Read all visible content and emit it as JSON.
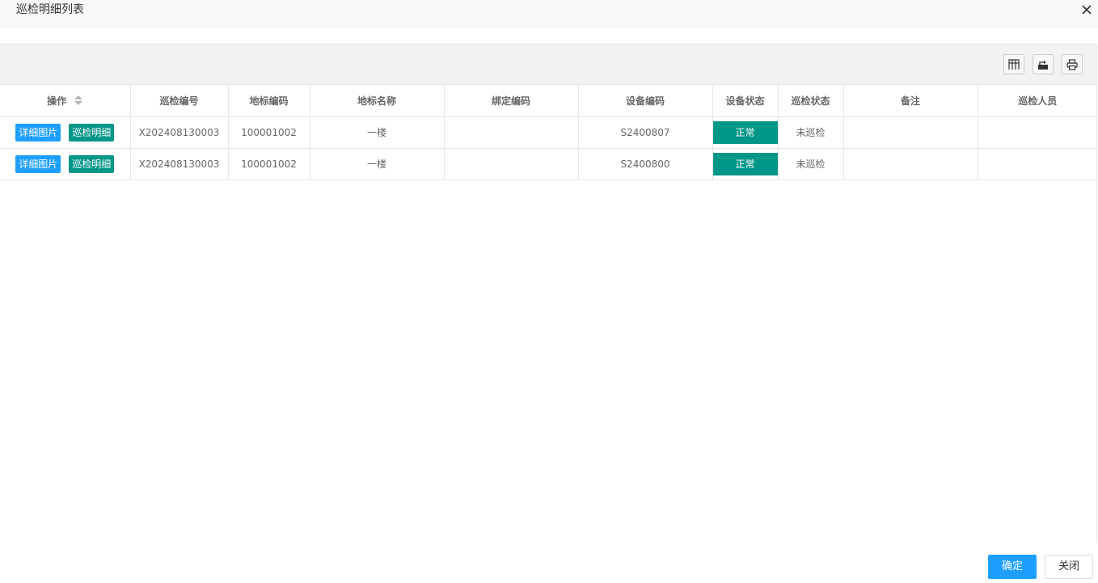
{
  "dialog": {
    "title": "巡检明细列表",
    "close_icon": "close-icon"
  },
  "toolbar": {
    "icons": [
      "columns-filter-icon",
      "export-icon",
      "print-icon"
    ]
  },
  "table": {
    "headers": [
      "操作",
      "巡检编号",
      "地标编码",
      "地标名称",
      "绑定编码",
      "设备编码",
      "设备状态",
      "巡检状态",
      "备注",
      "巡检人员"
    ],
    "row_actions": {
      "detail_image": "详细图片",
      "inspection_detail": "巡检明细"
    },
    "rows": [
      {
        "inspection_no": "X202408130003",
        "landmark_code": "100001002",
        "landmark_name": "一楼",
        "binding_code": "",
        "device_code": "S2400807",
        "device_status": "正常",
        "inspection_status": "未巡检",
        "remark": "",
        "inspector": ""
      },
      {
        "inspection_no": "X202408130003",
        "landmark_code": "100001002",
        "landmark_name": "一楼",
        "binding_code": "",
        "device_code": "S2400800",
        "device_status": "正常",
        "inspection_status": "未巡检",
        "remark": "",
        "inspector": ""
      }
    ]
  },
  "colors": {
    "primary_blue": "#1e9fff",
    "teal": "#009688"
  },
  "footer": {
    "confirm_label": "确定",
    "close_label": "关闭"
  }
}
